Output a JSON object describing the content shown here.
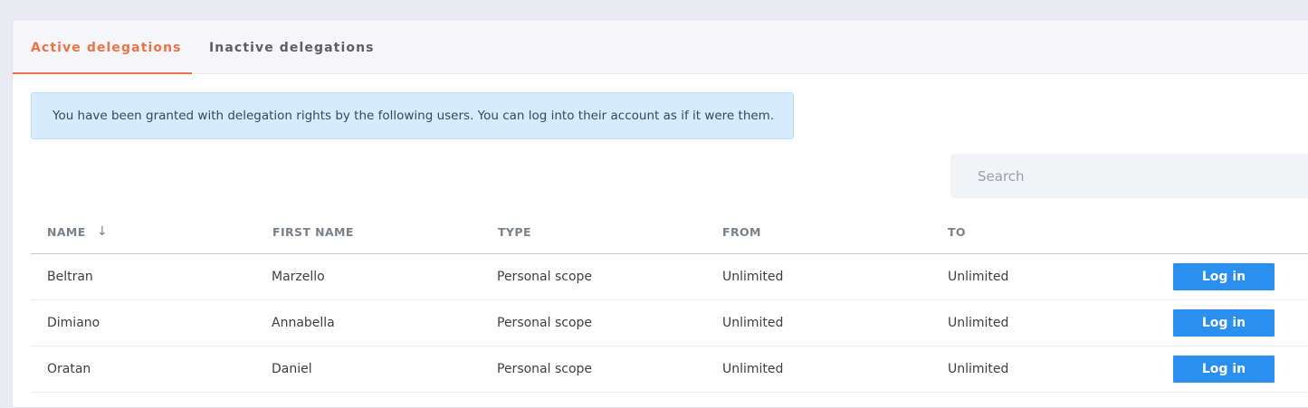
{
  "tabs": [
    {
      "label": "Active delegations",
      "active": true
    },
    {
      "label": "Inactive delegations",
      "active": false
    }
  ],
  "alert": {
    "text": "You have been granted with delegation rights by the following users. You can log into their account as if it were them."
  },
  "search": {
    "placeholder": "Search",
    "value": ""
  },
  "table": {
    "columns": [
      "NAME",
      "FIRST NAME",
      "TYPE",
      "FROM",
      "TO"
    ],
    "sort_icon": "arrow-down-icon",
    "rows": [
      {
        "name": "Beltran",
        "first_name": "Marzello",
        "type": "Personal scope",
        "from": "Unlimited",
        "to": "Unlimited",
        "action": "Log in"
      },
      {
        "name": "Dimiano",
        "first_name": "Annabella",
        "type": "Personal scope",
        "from": "Unlimited",
        "to": "Unlimited",
        "action": "Log in"
      },
      {
        "name": "Oratan",
        "first_name": "Daniel",
        "type": "Personal scope",
        "from": "Unlimited",
        "to": "Unlimited",
        "action": "Log in"
      }
    ]
  },
  "colors": {
    "accent": "#ee7248",
    "button": "#2b8ff0",
    "alert_bg": "#d6ebfb"
  }
}
